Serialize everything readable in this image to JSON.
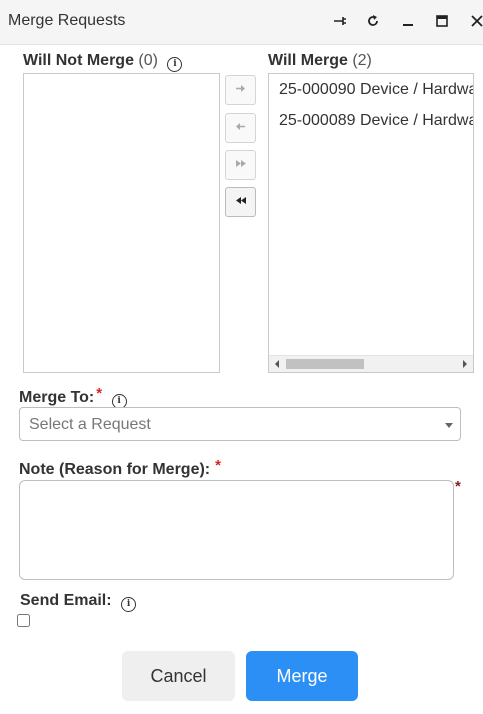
{
  "window": {
    "title": "Merge Requests",
    "controls": [
      "pin-icon",
      "refresh-icon",
      "minimize-icon",
      "maximize-icon",
      "close-icon"
    ]
  },
  "will_not_merge": {
    "label": "Will Not Merge",
    "count": "(0)",
    "items": []
  },
  "will_merge": {
    "label": "Will Merge",
    "count": "(2)",
    "items": [
      "25-000090 Device / Hardwa",
      "25-000089 Device / Hardwa"
    ]
  },
  "transfer_buttons": [
    "arrow-right-icon",
    "arrow-left-icon",
    "double-arrow-right-icon",
    "double-arrow-left-icon"
  ],
  "merge_to": {
    "label": "Merge To:",
    "required_mark": "*",
    "placeholder": "Select a Request"
  },
  "note": {
    "label": "Note (Reason for Merge):",
    "required_mark": "*",
    "value": ""
  },
  "send_email": {
    "label": "Send Email:",
    "checked": false
  },
  "buttons": {
    "cancel": "Cancel",
    "merge": "Merge"
  },
  "colors": {
    "primary": "#2b8ff5",
    "required": "#d22222",
    "asterisk_dark": "#8b1a1a"
  }
}
